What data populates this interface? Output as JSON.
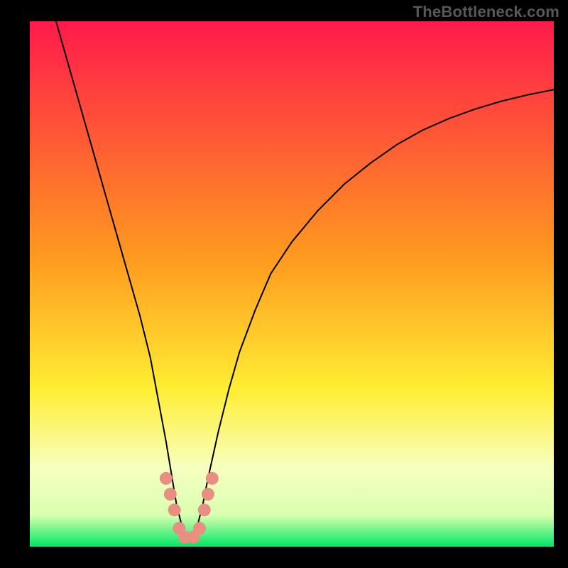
{
  "watermark": {
    "text": "TheBottleneck.com"
  },
  "chart_data": {
    "type": "line",
    "title": "",
    "xlabel": "",
    "ylabel": "",
    "xlim": [
      0,
      100
    ],
    "ylim": [
      0,
      100
    ],
    "background_gradient": {
      "stops": [
        {
          "offset": 0.0,
          "color": "#ff1a4b"
        },
        {
          "offset": 0.45,
          "color": "#ff9a1f"
        },
        {
          "offset": 0.7,
          "color": "#ffee33"
        },
        {
          "offset": 0.85,
          "color": "#f7ffbf"
        },
        {
          "offset": 0.94,
          "color": "#d9ffb0"
        },
        {
          "offset": 1.0,
          "color": "#00e765"
        }
      ]
    },
    "series": [
      {
        "name": "bottleneck-curve",
        "color": "#000000",
        "width": 2,
        "x": [
          5,
          7,
          9,
          11,
          13,
          15,
          17,
          19,
          21,
          23,
          24.5,
          26,
          27,
          28,
          29,
          30,
          31,
          32,
          33,
          34,
          36,
          38,
          40,
          43,
          46,
          50,
          55,
          60,
          65,
          70,
          75,
          80,
          85,
          90,
          95,
          100
        ],
        "y": [
          100,
          93,
          86,
          79,
          72,
          65,
          58,
          51,
          44,
          36,
          28,
          20,
          14,
          8,
          4,
          1.5,
          1.5,
          4,
          8,
          13,
          22,
          30,
          37,
          45,
          52,
          58,
          64,
          69,
          73,
          76.5,
          79.3,
          81.5,
          83.3,
          84.8,
          86,
          87
        ]
      }
    ],
    "markers": {
      "name": "highlight-dots",
      "color": "#e98e82",
      "radius": 9,
      "points": [
        {
          "x": 26.0,
          "y": 13
        },
        {
          "x": 26.8,
          "y": 10
        },
        {
          "x": 27.6,
          "y": 7
        },
        {
          "x": 28.5,
          "y": 3.5
        },
        {
          "x": 29.6,
          "y": 1.8
        },
        {
          "x": 31.2,
          "y": 1.8
        },
        {
          "x": 32.4,
          "y": 3.5
        },
        {
          "x": 33.3,
          "y": 7
        },
        {
          "x": 34.0,
          "y": 10
        },
        {
          "x": 34.8,
          "y": 13
        }
      ]
    }
  }
}
